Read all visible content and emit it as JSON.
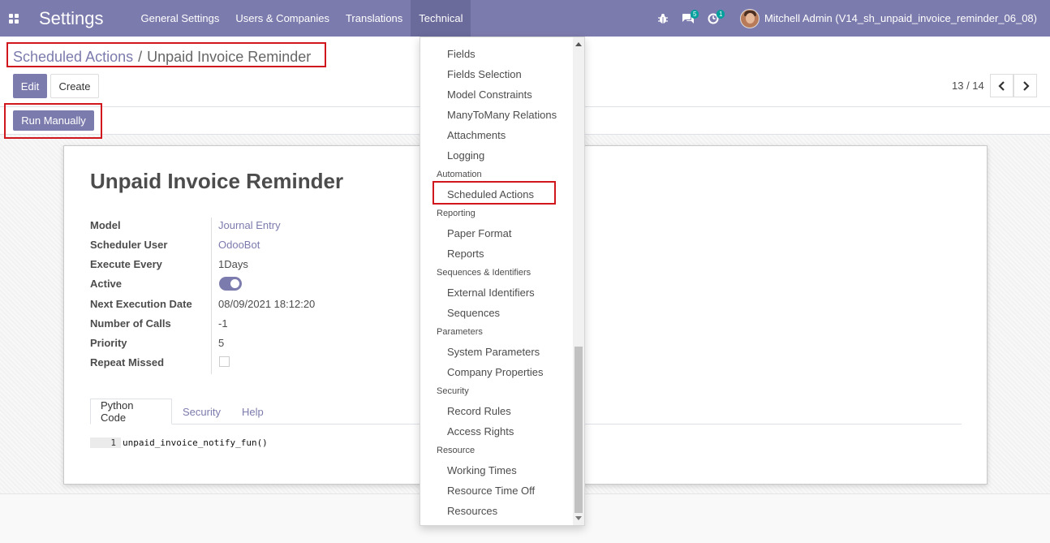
{
  "navbar": {
    "app_title": "Settings",
    "menu": [
      "General Settings",
      "Users & Companies",
      "Translations",
      "Technical"
    ],
    "messages_count": "5",
    "activities_count": "1",
    "user_name": "Mitchell Admin (V14_sh_unpaid_invoice_reminder_06_08)"
  },
  "breadcrumb": {
    "parent": "Scheduled Actions",
    "separator": "/",
    "current": "Unpaid Invoice Reminder"
  },
  "buttons": {
    "edit": "Edit",
    "create": "Create",
    "run_manually": "Run Manually"
  },
  "pager": {
    "value": "13 / 14"
  },
  "record": {
    "title": "Unpaid Invoice Reminder",
    "fields": [
      {
        "label": "Model",
        "value": "Journal Entry"
      },
      {
        "label": "Scheduler User",
        "value": "OdooBot"
      },
      {
        "label": "Execute Every",
        "value": "1Days"
      },
      {
        "label": "Active",
        "value": ""
      },
      {
        "label": "Next Execution Date",
        "value": "08/09/2021 18:12:20"
      },
      {
        "label": "Number of Calls",
        "value": "-1"
      },
      {
        "label": "Priority",
        "value": "5"
      },
      {
        "label": "Repeat Missed",
        "value": ""
      }
    ],
    "active": true,
    "repeat_missed": false
  },
  "tabs": [
    "Python Code",
    "Security",
    "Help"
  ],
  "code": {
    "line_number": "1",
    "line": "unpaid_invoice_notify_fun()"
  },
  "dropdown": {
    "items": [
      {
        "kind": "item",
        "label": "Fields"
      },
      {
        "kind": "item",
        "label": "Fields Selection"
      },
      {
        "kind": "item",
        "label": "Model Constraints"
      },
      {
        "kind": "item",
        "label": "ManyToMany Relations"
      },
      {
        "kind": "item",
        "label": "Attachments"
      },
      {
        "kind": "item",
        "label": "Logging"
      },
      {
        "kind": "header",
        "label": "Automation"
      },
      {
        "kind": "item",
        "label": "Scheduled Actions"
      },
      {
        "kind": "header",
        "label": "Reporting"
      },
      {
        "kind": "item",
        "label": "Paper Format"
      },
      {
        "kind": "item",
        "label": "Reports"
      },
      {
        "kind": "header",
        "label": "Sequences & Identifiers"
      },
      {
        "kind": "item",
        "label": "External Identifiers"
      },
      {
        "kind": "item",
        "label": "Sequences"
      },
      {
        "kind": "header",
        "label": "Parameters"
      },
      {
        "kind": "item",
        "label": "System Parameters"
      },
      {
        "kind": "item",
        "label": "Company Properties"
      },
      {
        "kind": "header",
        "label": "Security"
      },
      {
        "kind": "item",
        "label": "Record Rules"
      },
      {
        "kind": "item",
        "label": "Access Rights"
      },
      {
        "kind": "header",
        "label": "Resource"
      },
      {
        "kind": "item",
        "label": "Working Times"
      },
      {
        "kind": "item",
        "label": "Resource Time Off"
      },
      {
        "kind": "item",
        "label": "Resources"
      }
    ]
  },
  "colors": {
    "brand": "#7c7bad",
    "highlight": "#d0171d",
    "badge": "#00a09d"
  }
}
